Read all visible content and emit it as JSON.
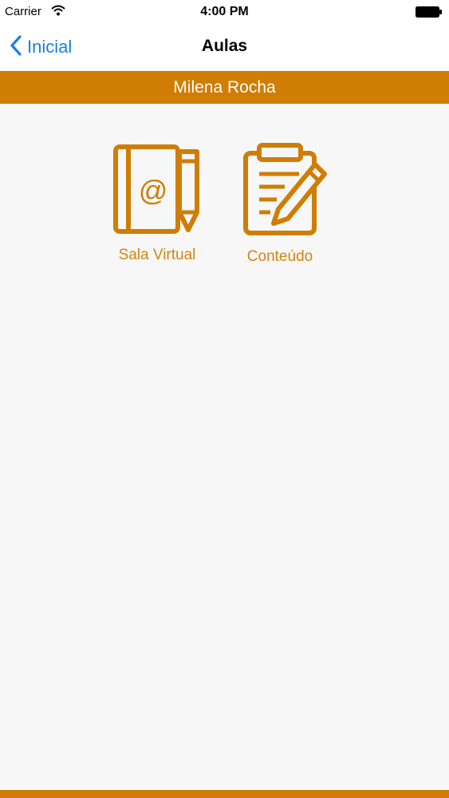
{
  "status_bar": {
    "carrier": "Carrier",
    "time": "4:00 PM",
    "icons": [
      "wifi-icon",
      "battery-icon"
    ]
  },
  "nav": {
    "back_label": "Inicial",
    "title": "Aulas"
  },
  "banner": {
    "name": "Milena Rocha"
  },
  "tiles": [
    {
      "label": "Sala Virtual",
      "icon": "address-book-pencil-icon"
    },
    {
      "label": "Conteúdo",
      "icon": "clipboard-pencil-icon"
    }
  ],
  "colors": {
    "accent": "#cf7d04",
    "tile_label": "#d4850f",
    "link": "#1a7fe6",
    "background": "#f7f7f7"
  }
}
